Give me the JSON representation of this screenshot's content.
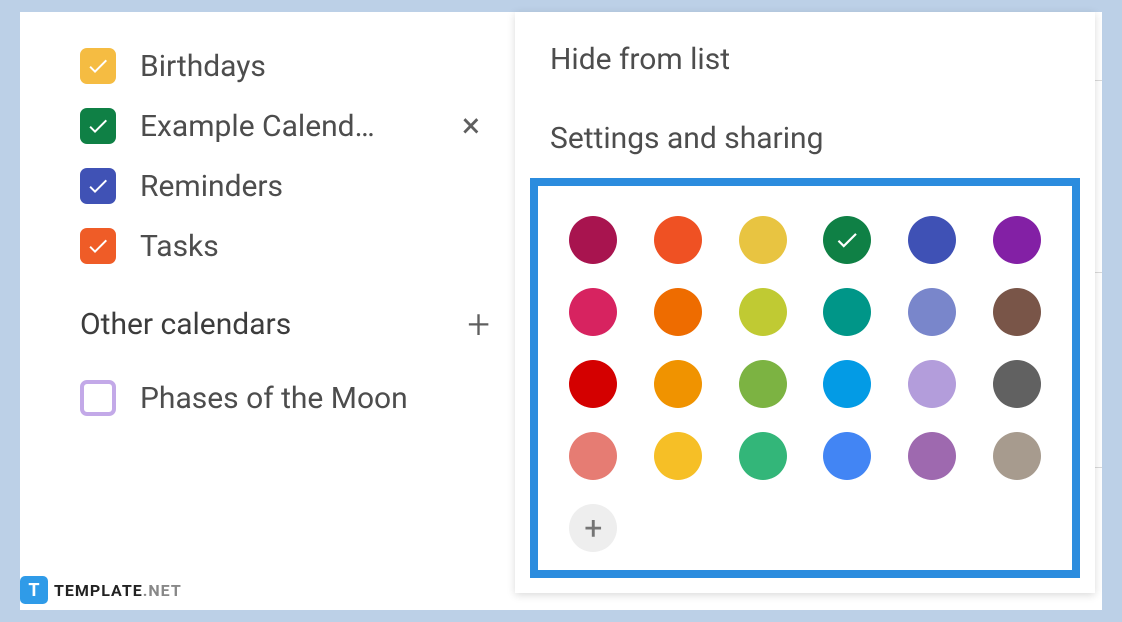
{
  "calendars": [
    {
      "label": "Birthdays",
      "color": "#f5bc42",
      "checked": true,
      "hovered": false
    },
    {
      "label": "Example Calend…",
      "color": "#0f8045",
      "checked": true,
      "hovered": true
    },
    {
      "label": "Reminders",
      "color": "#4052b5",
      "checked": true,
      "hovered": false
    },
    {
      "label": "Tasks",
      "color": "#ef5c27",
      "checked": true,
      "hovered": false
    }
  ],
  "otherSection": {
    "title": "Other calendars",
    "items": [
      {
        "label": "Phases of the Moon",
        "color": "#c3a9e8",
        "checked": false
      }
    ]
  },
  "popup": {
    "menu": [
      {
        "label": "Hide from list"
      },
      {
        "label": "Settings and sharing"
      }
    ],
    "colors": [
      {
        "hex": "#a8144f",
        "selected": false
      },
      {
        "hex": "#ef5123",
        "selected": false
      },
      {
        "hex": "#e8c441",
        "selected": false
      },
      {
        "hex": "#0f8045",
        "selected": true
      },
      {
        "hex": "#3f51b5",
        "selected": false
      },
      {
        "hex": "#8320a5",
        "selected": false
      },
      {
        "hex": "#d72360",
        "selected": false
      },
      {
        "hex": "#ee6c00",
        "selected": false
      },
      {
        "hex": "#c0ca33",
        "selected": false
      },
      {
        "hex": "#009688",
        "selected": false
      },
      {
        "hex": "#7986cb",
        "selected": false
      },
      {
        "hex": "#795548",
        "selected": false
      },
      {
        "hex": "#d40000",
        "selected": false
      },
      {
        "hex": "#f09300",
        "selected": false
      },
      {
        "hex": "#7cb342",
        "selected": false
      },
      {
        "hex": "#039be5",
        "selected": false
      },
      {
        "hex": "#b39ddb",
        "selected": false
      },
      {
        "hex": "#616161",
        "selected": false
      },
      {
        "hex": "#e67c73",
        "selected": false
      },
      {
        "hex": "#f6bf26",
        "selected": false
      },
      {
        "hex": "#33b679",
        "selected": false
      },
      {
        "hex": "#4285f4",
        "selected": false
      },
      {
        "hex": "#9e69af",
        "selected": false
      },
      {
        "hex": "#a79b8e",
        "selected": false
      }
    ]
  },
  "watermark": {
    "icon": "T",
    "text1": "TEMPLATE",
    "text2": ".NET"
  }
}
